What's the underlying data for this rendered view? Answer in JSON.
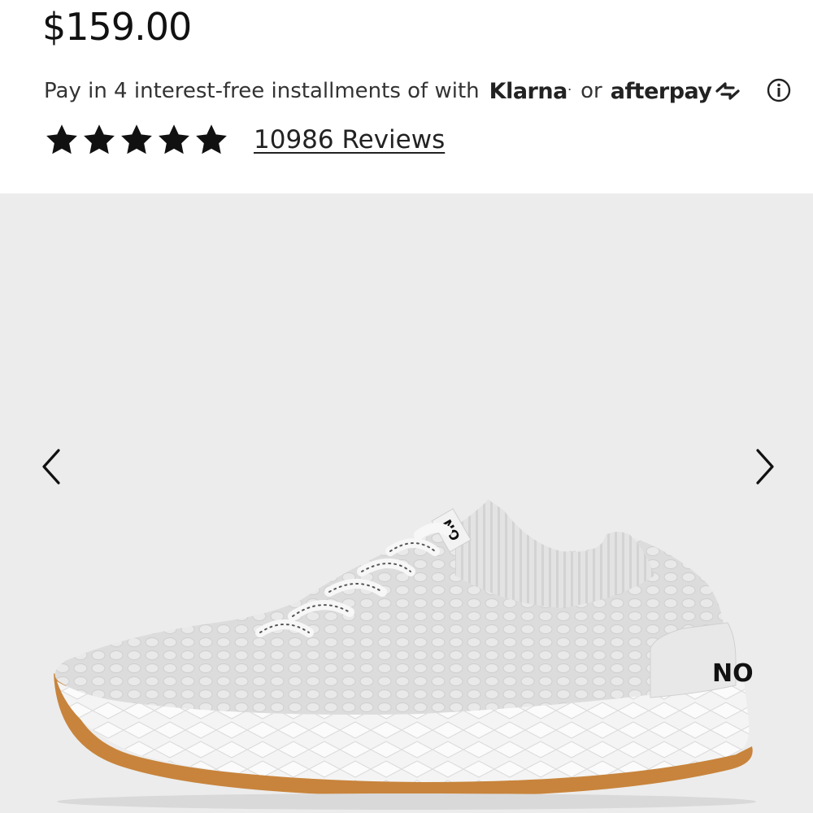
{
  "product": {
    "price": "$159.00",
    "payment": {
      "text": "Pay in 4 interest-free installments of with",
      "klarna": "Klarna",
      "klarna_mark": ".",
      "or": "or",
      "afterpay": "afterpay"
    },
    "rating": {
      "stars": 5,
      "reviews_label": "10986 Reviews"
    },
    "shoe_branding": {
      "heel_text": "NO",
      "tongue_text": "NO"
    }
  },
  "colors": {
    "text": "#111111",
    "image_background": "#ececec",
    "sole_gum": "#c8843c"
  },
  "icons": {
    "info": "info-icon",
    "star": "star-icon",
    "prev": "chevron-left-icon",
    "next": "chevron-right-icon"
  }
}
